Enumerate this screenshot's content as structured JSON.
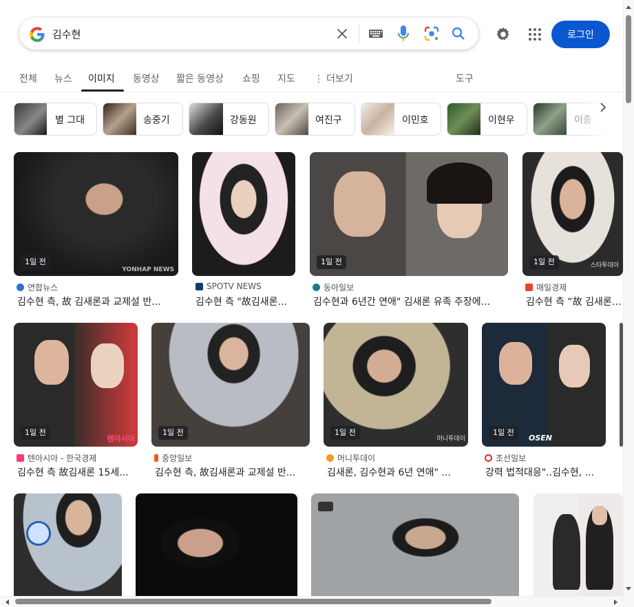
{
  "search": {
    "query": "김수현"
  },
  "header": {
    "login_label": "로그인"
  },
  "tabs": [
    {
      "label": "전체"
    },
    {
      "label": "뉴스"
    },
    {
      "label": "이미지"
    },
    {
      "label": "동영상"
    },
    {
      "label": "짧은 동영상"
    },
    {
      "label": "쇼핑"
    },
    {
      "label": "지도"
    },
    {
      "label": "더보기"
    },
    {
      "label": "도구"
    }
  ],
  "chips": [
    {
      "label": "별 그대"
    },
    {
      "label": "송중기"
    },
    {
      "label": "강동원"
    },
    {
      "label": "여진구"
    },
    {
      "label": "이민호"
    },
    {
      "label": "이현우"
    },
    {
      "label": "이종"
    }
  ],
  "results": [
    {
      "badge": "1일 전",
      "source": "연합뉴스",
      "title": "김수현 측, 故 김새론과 교제설 반...",
      "watermark": "YONHAP NEWS"
    },
    {
      "badge": "",
      "source": "SPOTV NEWS",
      "title": "김수현 측 \"故김새론...",
      "watermark": ""
    },
    {
      "badge": "1일 전",
      "source": "동아일보",
      "title": "김수현과 6년간 연애\" 김새론 유족 주장에...",
      "watermark": ""
    },
    {
      "badge": "1일 전",
      "source": "매일경제",
      "title": "김수현 측 “故 김새론 ...",
      "watermark": "스타투데이"
    },
    {
      "badge": "1일 전",
      "source": "텐아시아 - 한국경제",
      "title": "김수현 측 故김새론 15세...",
      "watermark": "텐아시아"
    },
    {
      "badge": "1일 전",
      "source": "중앙일보",
      "title": "김수현 측, 故김새론과 교제설 반...",
      "watermark": ""
    },
    {
      "badge": "1일 전",
      "source": "머니투데이",
      "title": "김새론, 김수현과 6년 연애\" ...",
      "watermark": "머니투데이"
    },
    {
      "badge": "1일 전",
      "source": "조선일보",
      "title": "강력 법적대응\"..김수현, ...",
      "watermark": "OSEN"
    }
  ],
  "colors": {
    "accent": "#0b57d0",
    "text": "#202124",
    "muted": "#5f6368"
  }
}
